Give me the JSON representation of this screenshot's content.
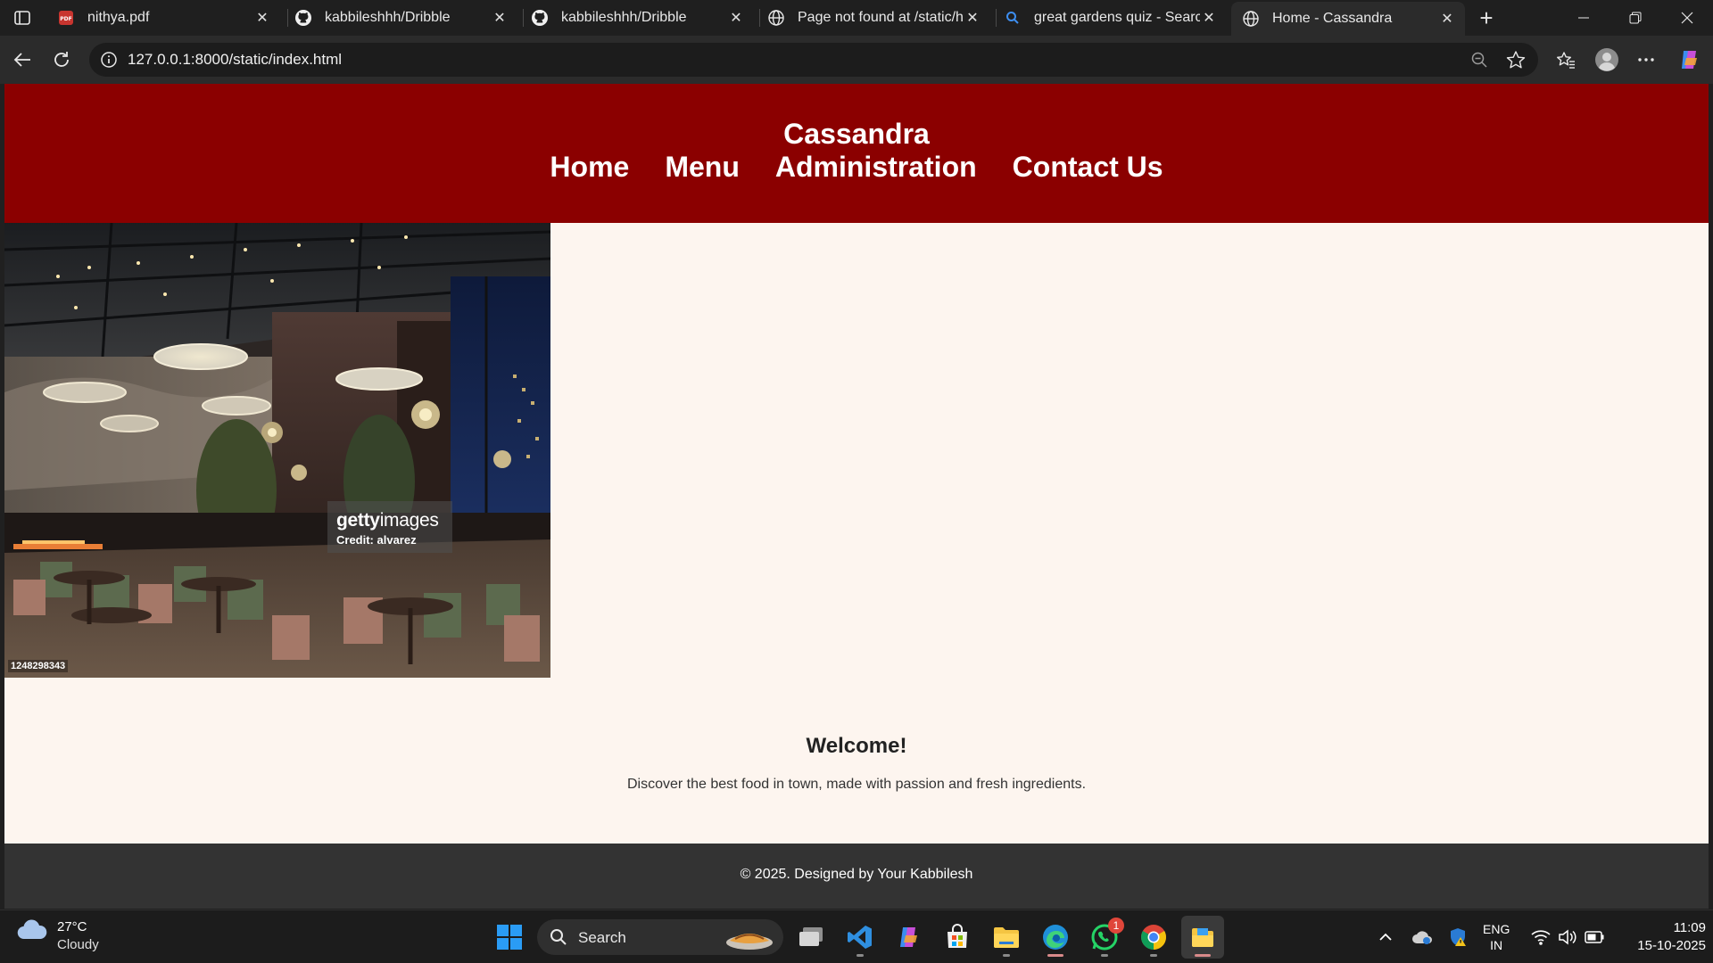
{
  "browser": {
    "tabs": [
      {
        "title": "nithya.pdf",
        "icon": "pdf-icon"
      },
      {
        "title": "kabbileshhh/Dribble",
        "icon": "github-icon"
      },
      {
        "title": "kabbileshhh/Dribble",
        "icon": "github-icon"
      },
      {
        "title": "Page not found at /static/ho",
        "icon": "globe-icon"
      },
      {
        "title": "great gardens quiz - Search",
        "icon": "search-icon"
      },
      {
        "title": "Home - Cassandra",
        "icon": "globe-icon",
        "active": true
      }
    ],
    "url": "127.0.0.1:8000/static/index.html"
  },
  "site": {
    "title": "Cassandra",
    "nav": [
      "Home",
      "Menu",
      "Administration",
      "Contact Us"
    ],
    "hero": {
      "watermark_logo": "gettyimages",
      "credit": "Credit: alvarez",
      "image_id": "1248298343"
    },
    "welcome": {
      "heading": "Welcome!",
      "text": "Discover the best food in town, made with passion and fresh ingredients."
    },
    "footer": "© 2025. Designed by Your Kabbilesh",
    "colors": {
      "header": "#8b0000",
      "body": "#fdf5ef",
      "footer": "#333333"
    }
  },
  "taskbar": {
    "weather": {
      "temp": "27°C",
      "condition": "Cloudy"
    },
    "search_label": "Search",
    "whatsapp_badge": "1",
    "lang": {
      "line1": "ENG",
      "line2": "IN"
    },
    "time": "11:09",
    "date": "15-10-2025"
  }
}
